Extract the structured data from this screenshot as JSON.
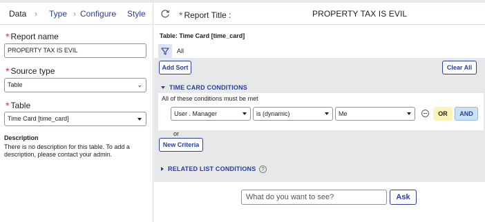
{
  "tabs": {
    "data": "Data",
    "type": "Type",
    "configure": "Configure",
    "style": "Style"
  },
  "left": {
    "report_name_label": "Report name",
    "report_name_value": "PROPERTY TAX IS EVIL",
    "source_type_label": "Source type",
    "source_type_value": "Table",
    "table_label": "Table",
    "table_value": "Time Card [time_card]",
    "description_title": "Description",
    "description_text": "There is no description for this table. To add a description, please contact your admin."
  },
  "header": {
    "report_title_label": "Report Title :",
    "report_title_value": "PROPERTY TAX IS EVIL"
  },
  "main": {
    "table_line": "Table: Time Card [time_card]",
    "all_label": "All",
    "add_sort": "Add Sort",
    "clear_all": "Clear All",
    "conditions_title": "TIME CARD CONDITIONS",
    "conditions_intro": "All of these conditions must be met",
    "condition": {
      "field": "User . Manager",
      "operator": "is (dynamic)",
      "value": "Me"
    },
    "or_button": "OR",
    "and_button": "AND",
    "or_text": "or",
    "new_criteria": "New Criteria",
    "related_title": "RELATED LIST CONDITIONS",
    "help_glyph": "?",
    "ask_placeholder": "What do you want to see?",
    "ask_button": "Ask"
  },
  "colors": {
    "accent": "#293e9b",
    "required": "#c83c36",
    "gray_panel": "#e6e8ea",
    "or_bg": "#fbf4b8",
    "and_bg": "#cbe1f5"
  },
  "icons": [
    "refresh-icon",
    "filter-icon",
    "minus-circle-icon",
    "help-icon",
    "chevron-right-icon"
  ]
}
